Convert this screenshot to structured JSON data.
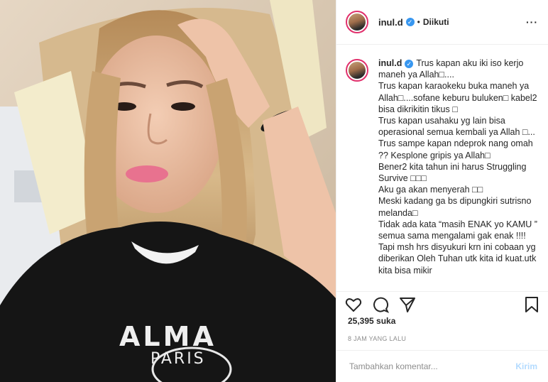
{
  "post": {
    "username": "inul.d",
    "verified_icon": "verified-badge-icon",
    "follow_separator": "•",
    "follow_status": "Diikuti",
    "more_label": "···",
    "caption_user": "inul.d",
    "caption_text": "Trus kapan aku iki iso kerjo maneh ya Allah□....\nTrus kapan karaokeku buka maneh ya Allah□....sofane keburu buluken□ kabel2 bisa dikrikitin tikus □\nTrus kapan usahaku yg lain bisa operasional semua kembali ya Allah □...\nTrus sampe kapan ndeprok nang omah ?? Kesplone gripis ya Allah□\nBener2 kita tahun ini harus Struggling Survive □□□\nAku ga akan menyerah □□\nMeski kadang ga bs dipungkiri sutrisno melanda□\nTidak ada kata “masih ENAK yo KAMU ” semua sama mengalami gak enak !!!! Tapi msh hrs disyukuri krn ini cobaan yg diberikan Oleh Tuhan utk kita id kuat.utk kita bisa mikir",
    "likes": "25,395 suka",
    "time": "8 JAM YANG LALU",
    "comment_placeholder": "Tambahkan komentar...",
    "send_label": "Kirim",
    "icons": [
      "heart-icon",
      "comment-icon",
      "share-icon",
      "bookmark-icon"
    ],
    "shirt_text_1": "ALMA",
    "shirt_text_2": "PARIS"
  },
  "colors": {
    "verified": "#3897f0",
    "story_ring": "#e1306c",
    "send_disabled": "#b3dbff",
    "muted": "#8e8e8e"
  }
}
